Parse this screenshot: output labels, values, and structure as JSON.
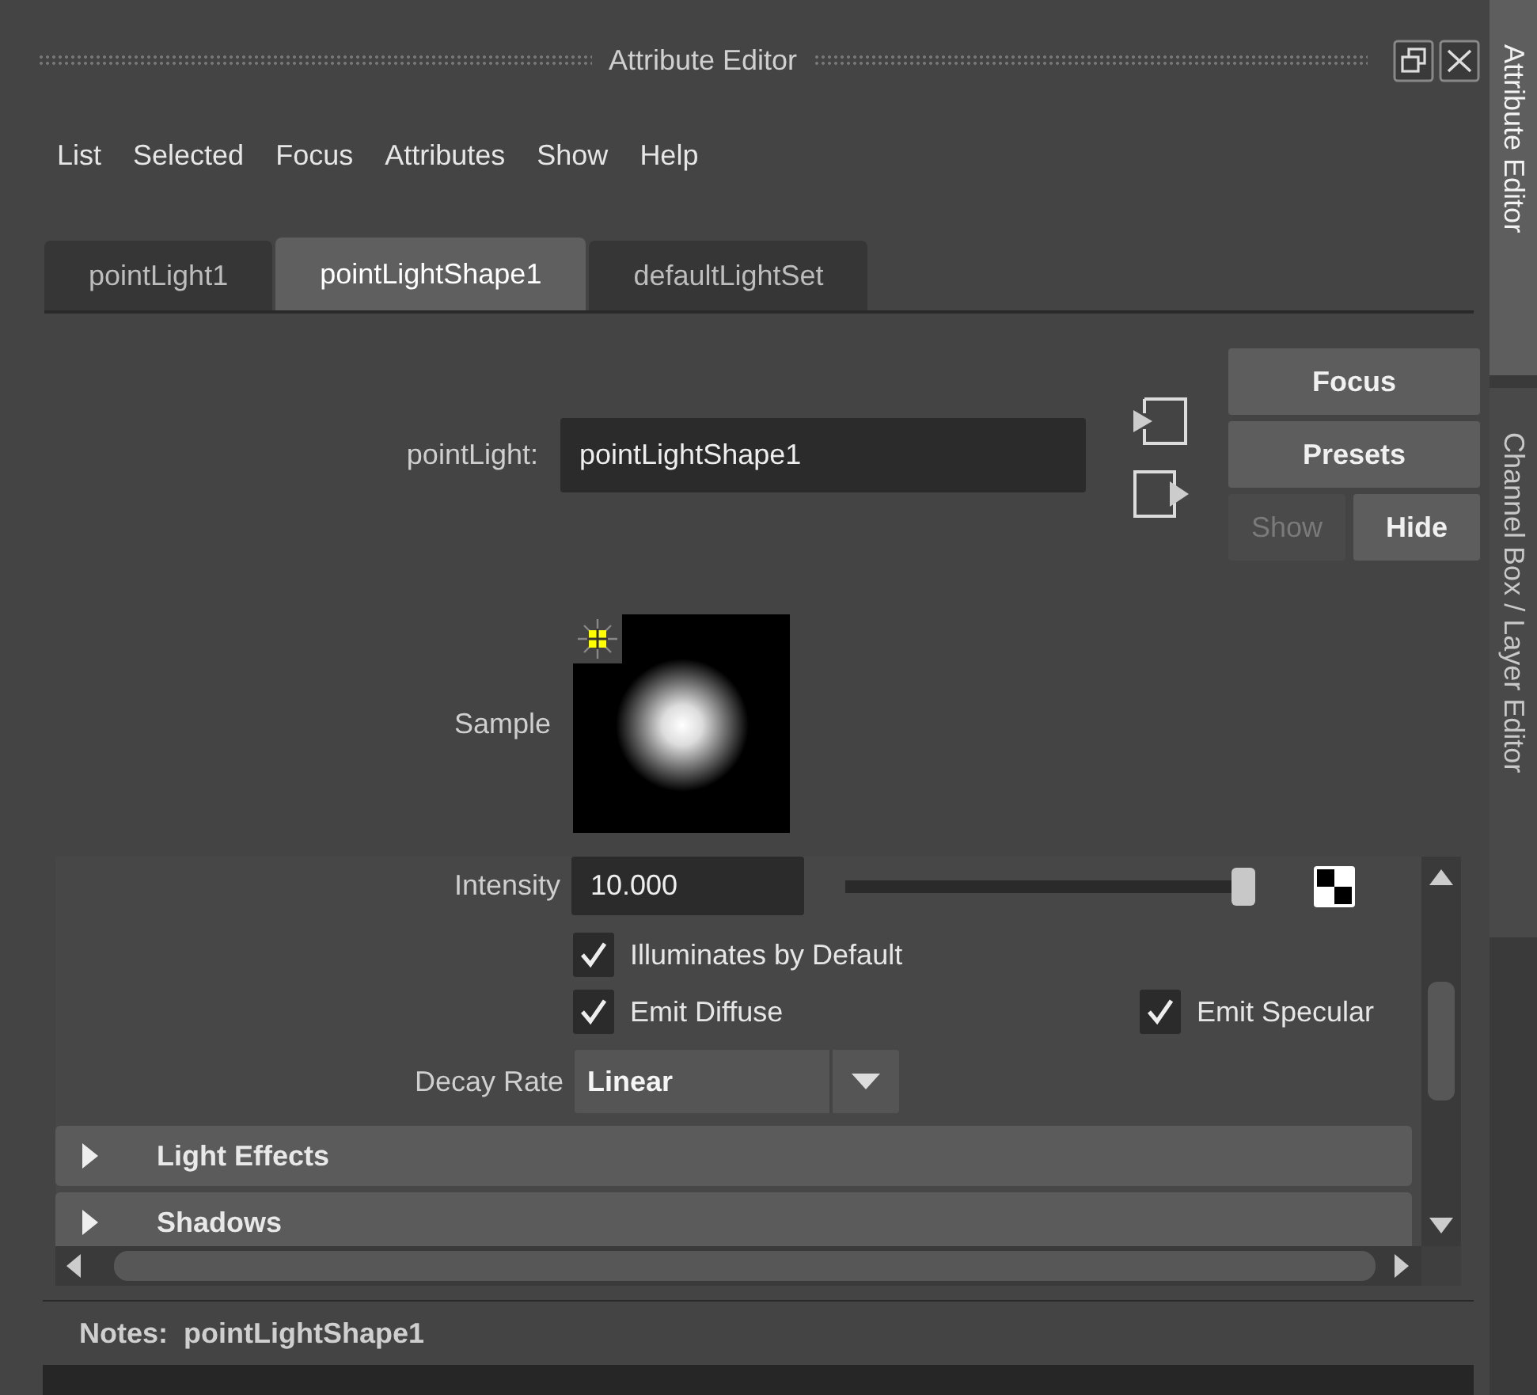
{
  "window": {
    "title": "Attribute Editor"
  },
  "menu": [
    "List",
    "Selected",
    "Focus",
    "Attributes",
    "Show",
    "Help"
  ],
  "tabs": [
    {
      "label": "pointLight1",
      "selected": false
    },
    {
      "label": "pointLightShape1",
      "selected": true
    },
    {
      "label": "defaultLightSet",
      "selected": false
    }
  ],
  "node": {
    "label": "pointLight:",
    "value": "pointLightShape1"
  },
  "buttons": [
    {
      "label": "Focus",
      "disabled": false
    },
    {
      "label": "Presets",
      "disabled": false
    },
    {
      "label": "Show",
      "disabled": true
    },
    {
      "label": "Hide",
      "disabled": false
    }
  ],
  "sample": {
    "label": "Sample"
  },
  "attributes": [
    {
      "kind": "slider",
      "label": "Intensity",
      "value": "10.000",
      "level": 0.97
    },
    {
      "kind": "checkboxes",
      "items": [
        {
          "label": "Illuminates by Default",
          "checked": true
        }
      ]
    },
    {
      "kind": "checkboxes",
      "items": [
        {
          "label": "Emit Diffuse",
          "checked": true
        },
        {
          "label": "Emit Specular",
          "checked": true
        }
      ]
    },
    {
      "kind": "dropdown",
      "label": "Decay Rate",
      "value": "Linear"
    }
  ],
  "sections": [
    {
      "label": "Light Effects",
      "expanded": false
    },
    {
      "label": "Shadows",
      "expanded": false
    }
  ],
  "notes": {
    "label": "Notes:",
    "value": "pointLightShape1"
  },
  "side_tabs": [
    {
      "label": "Attribute Editor",
      "selected": true
    },
    {
      "label": "Channel Box / Layer Editor",
      "selected": false
    }
  ]
}
